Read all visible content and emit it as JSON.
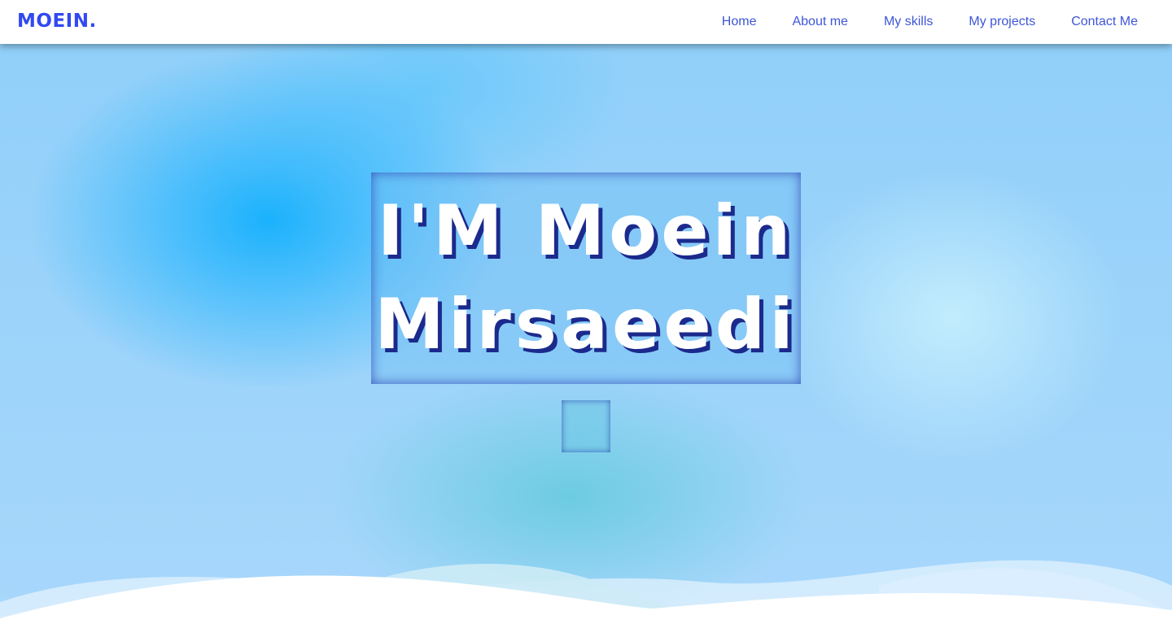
{
  "navbar": {
    "logo": "MOEIN.",
    "links": [
      "Home",
      "About me",
      "My skills",
      "My projects",
      "Contact Me"
    ]
  },
  "hero": {
    "title_line1": "I'M Moein",
    "title_line2": "Mirsaeedi"
  },
  "colors": {
    "brand": "#3149f0",
    "nav_link": "#3e56d6",
    "title_shadow": "#1b2a8c"
  }
}
